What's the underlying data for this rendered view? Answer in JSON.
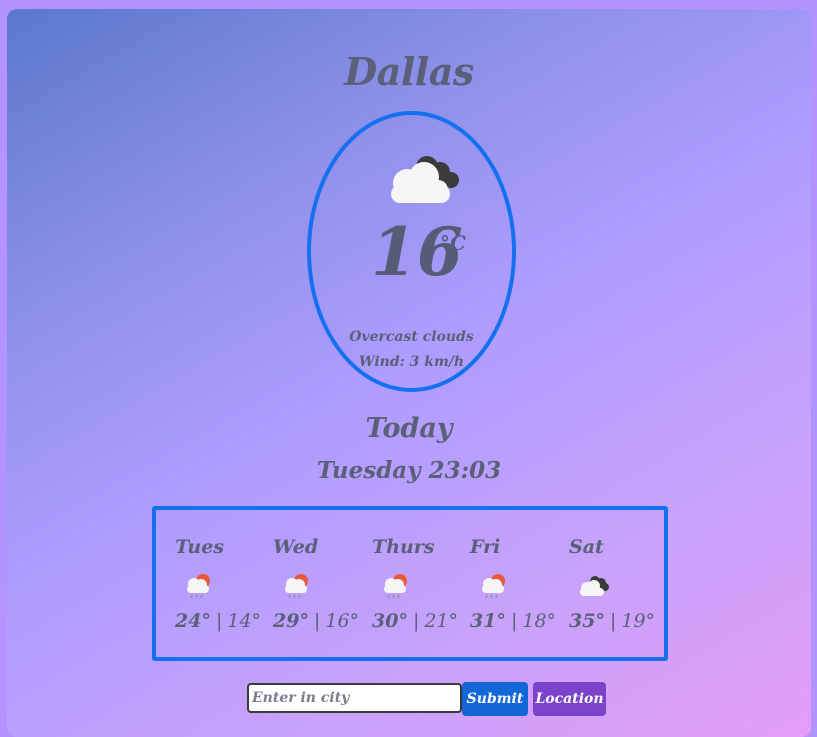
{
  "city": "Dallas",
  "current": {
    "icon": "overcast-clouds-icon",
    "temperature": "16",
    "unit": "°C",
    "description": "Overcast clouds",
    "wind": "Wind: 3 km/h"
  },
  "today": {
    "label": "Today",
    "datetime": "Tuesday 23:03"
  },
  "forecast": [
    {
      "day": "Tues",
      "icon": "rain-sun-icon",
      "high": "24°",
      "low": "14°"
    },
    {
      "day": "Wed",
      "icon": "rain-sun-icon",
      "high": "29°",
      "low": "16°"
    },
    {
      "day": "Thurs",
      "icon": "rain-sun-icon",
      "high": "30°",
      "low": "21°"
    },
    {
      "day": "Fri",
      "icon": "rain-sun-icon",
      "high": "31°",
      "low": "18°"
    },
    {
      "day": "Sat",
      "icon": "overcast-clouds-icon",
      "high": "35°",
      "low": "19°"
    }
  ],
  "search": {
    "placeholder": "Enter in city",
    "submit_label": "Submit",
    "location_label": "Location"
  },
  "colors": {
    "accent_border": "#1570f0",
    "submit_button": "#1366d6",
    "location_button": "#7a43c9",
    "text": "#5a5f7a"
  }
}
